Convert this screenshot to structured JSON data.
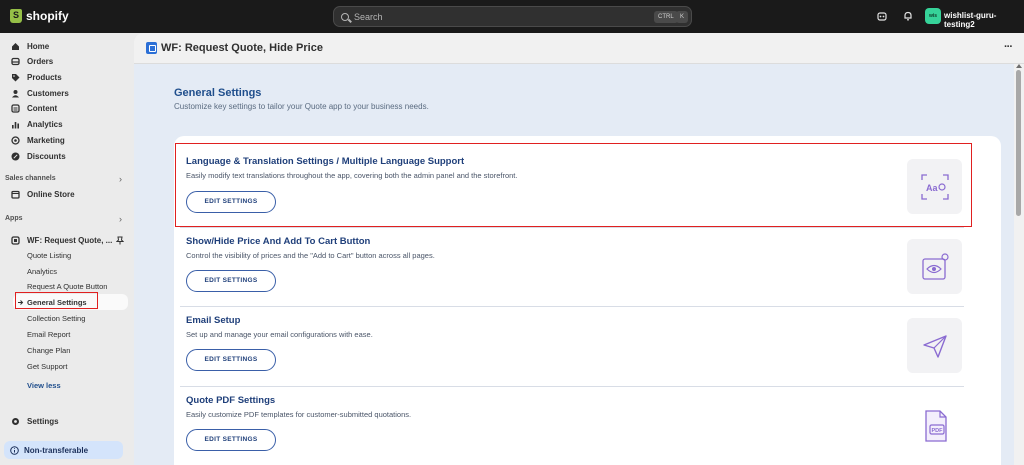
{
  "topbar": {
    "brand": "shopify",
    "search_placeholder": "Search",
    "shortcut_ctrl": "CTRL",
    "shortcut_k": "K",
    "store_initials": "wis",
    "store_name": "wishlist-guru-testing2"
  },
  "sidebar": {
    "main_items": [
      {
        "label": "Home",
        "icon": "home-icon"
      },
      {
        "label": "Orders",
        "icon": "orders-icon"
      },
      {
        "label": "Products",
        "icon": "tag-icon"
      },
      {
        "label": "Customers",
        "icon": "person-icon"
      },
      {
        "label": "Content",
        "icon": "content-icon"
      },
      {
        "label": "Analytics",
        "icon": "chart-icon"
      },
      {
        "label": "Marketing",
        "icon": "target-icon"
      },
      {
        "label": "Discounts",
        "icon": "discount-icon"
      }
    ],
    "sales_channels_label": "Sales channels",
    "online_store": "Online Store",
    "apps_label": "Apps",
    "app_name": "WF: Request Quote, ...",
    "app_subitems": [
      "Quote Listing",
      "Analytics",
      "Request A Quote Button",
      "General Settings",
      "Collection Setting",
      "Email Report",
      "Change Plan",
      "Get Support"
    ],
    "view_less": "View less",
    "settings": "Settings",
    "non_transferable": "Non-transferable"
  },
  "app_header": {
    "title": "WF: Request Quote, Hide Price"
  },
  "page": {
    "title": "General Settings",
    "subtitle": "Customize key settings to tailor your Quote app to your business needs."
  },
  "settings": [
    {
      "title": "Language & Translation Settings / Multiple Language Support",
      "desc": "Easily modify text translations throughout the app, covering both the admin panel and the storefront.",
      "button": "EDIT SETTINGS",
      "icon": "translate-icon"
    },
    {
      "title": "Show/Hide Price And Add To Cart Button",
      "desc": "Control the visibility of prices and the \"Add to Cart\" button across all pages.",
      "button": "EDIT SETTINGS",
      "icon": "eye-settings-icon"
    },
    {
      "title": "Email Setup",
      "desc": "Set up and manage your email configurations with ease.",
      "button": "EDIT SETTINGS",
      "icon": "send-icon"
    },
    {
      "title": "Quote PDF Settings",
      "desc": "Easily customize PDF templates for customer-submitted quotations.",
      "button": "EDIT SETTINGS",
      "icon": "pdf-icon"
    }
  ],
  "colors": {
    "accent": "#1f3f7a",
    "highlight": "#e02020",
    "icon_purple": "#8a6bd1"
  }
}
